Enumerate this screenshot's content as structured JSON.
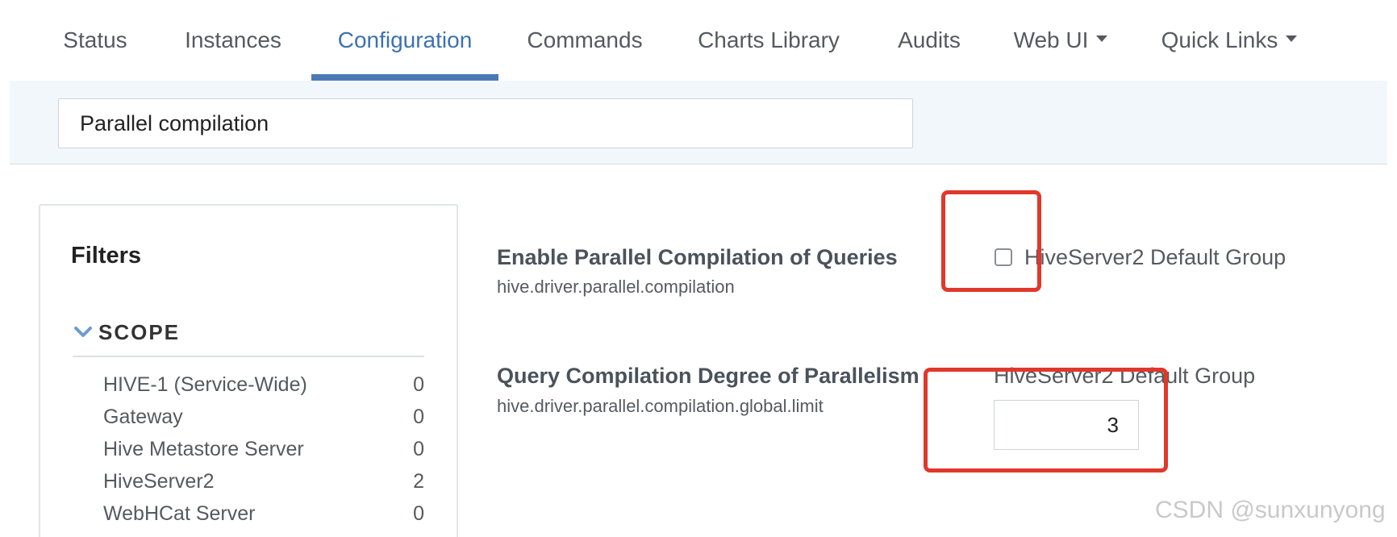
{
  "tabs": [
    {
      "label": "Status",
      "active": false,
      "dropdown": false
    },
    {
      "label": "Instances",
      "active": false,
      "dropdown": false
    },
    {
      "label": "Configuration",
      "active": true,
      "dropdown": false
    },
    {
      "label": "Commands",
      "active": false,
      "dropdown": false
    },
    {
      "label": "Charts Library",
      "active": false,
      "dropdown": false
    },
    {
      "label": "Audits",
      "active": false,
      "dropdown": false
    },
    {
      "label": "Web UI",
      "active": false,
      "dropdown": true
    },
    {
      "label": "Quick Links",
      "active": false,
      "dropdown": true
    }
  ],
  "search": {
    "value": "Parallel compilation"
  },
  "filters": {
    "title": "Filters",
    "scope": {
      "label": "SCOPE",
      "items": [
        {
          "label": "HIVE-1 (Service-Wide)",
          "count": "0"
        },
        {
          "label": "Gateway",
          "count": "0"
        },
        {
          "label": "Hive Metastore Server",
          "count": "0"
        },
        {
          "label": "HiveServer2",
          "count": "2"
        },
        {
          "label": "WebHCat Server",
          "count": "0"
        }
      ]
    }
  },
  "configs": [
    {
      "name": "Enable Parallel Compilation of Queries",
      "key": "hive.driver.parallel.compilation",
      "group": "HiveServer2 Default Group",
      "control": "checkbox",
      "checked": false
    },
    {
      "name": "Query Compilation Degree of Parallelism",
      "key": "hive.driver.parallel.compilation.global.limit",
      "group": "HiveServer2 Default Group",
      "control": "number",
      "value": "3"
    }
  ],
  "watermark": "CSDN @sunxunyong",
  "colors": {
    "accent": "#4b79b5",
    "highlight": "#e0382b",
    "search_band": "#f2f7fc"
  }
}
